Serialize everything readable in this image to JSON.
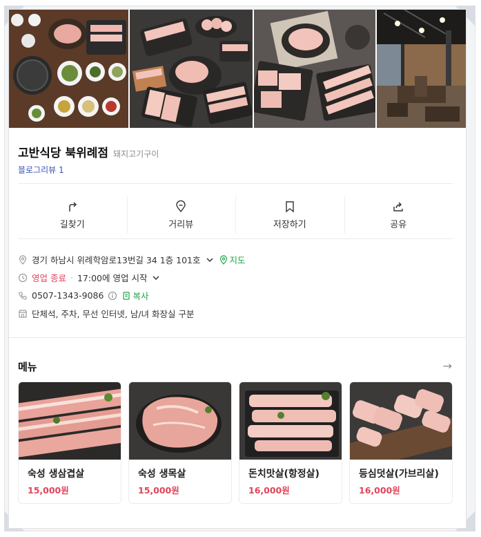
{
  "place": {
    "name": "고반식당 북위례점",
    "category": "돼지고기구이",
    "blog_review": "블로그리뷰 1"
  },
  "photos": [
    {
      "icon": "grill-table-photo"
    },
    {
      "icon": "pork-platter-photo"
    },
    {
      "icon": "pork-cuts-photo"
    },
    {
      "icon": "restaurant-interior-photo"
    }
  ],
  "actions": {
    "directions": "길찾기",
    "street_view": "거리뷰",
    "save": "저장하기",
    "share": "공유"
  },
  "info": {
    "address": "경기 하남시 위례학암로13번길 34 1층 101호",
    "map_link": "지도",
    "status": "영업 종료",
    "status_dot": "·",
    "hours": "17:00에 영업 시작",
    "phone": "0507-1343-9086",
    "copy": "복사",
    "facilities": "단체석, 주차, 무선 인터넷, 남/녀 화장실 구분"
  },
  "menu": {
    "heading": "메뉴",
    "arrow": "→",
    "items": [
      {
        "name": "숙성 생삼겹살",
        "price": "15,000원"
      },
      {
        "name": "숙성 생목살",
        "price": "15,000원"
      },
      {
        "name": "돈치맛살(항정살)",
        "price": "16,000원"
      },
      {
        "name": "등심덧살(가브리살)",
        "price": "16,000원"
      }
    ]
  },
  "colors": {
    "accent_green": "#1fa44a",
    "price_red": "#e0445a",
    "blog_blue": "#3a56b8"
  }
}
